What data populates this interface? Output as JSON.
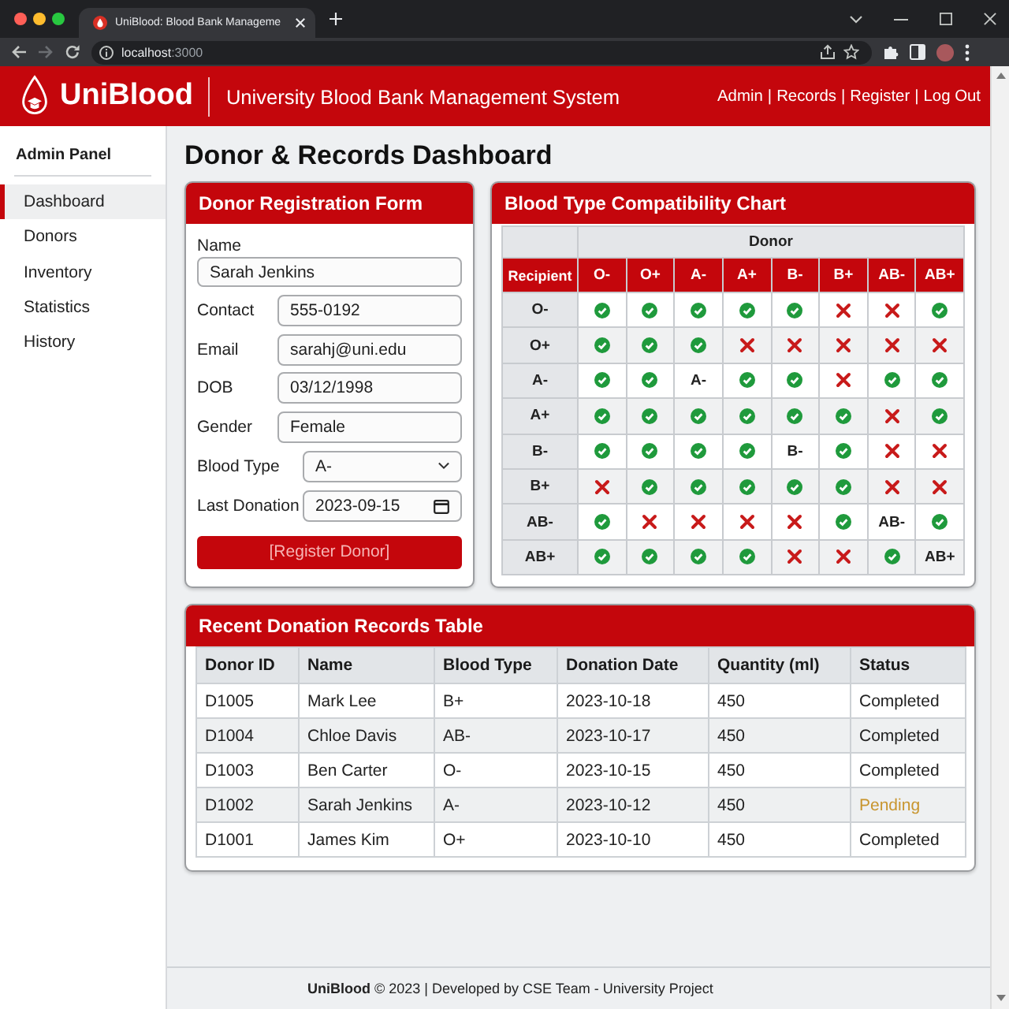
{
  "browser": {
    "tab": {
      "title": "UniBlood: Blood Bank Manageme"
    },
    "address": {
      "host": "localhost",
      "port": ":3000"
    },
    "forward_disabled": true
  },
  "header": {
    "brand": "UniBlood",
    "subtitle": "University Blood Bank Management System",
    "nav": {
      "links": [
        "Admin",
        "Records",
        "Register",
        "Log Out"
      ],
      "separator": "|"
    }
  },
  "sidebar": {
    "title": "Admin Panel",
    "items": [
      {
        "label": "Dashboard",
        "selected": true
      },
      {
        "label": "Donors",
        "selected": false
      },
      {
        "label": "Inventory",
        "selected": false
      },
      {
        "label": "Statistics",
        "selected": false
      },
      {
        "label": "History",
        "selected": false
      }
    ]
  },
  "page_title": "Donor & Records Dashboard",
  "registration_form": {
    "title": "Donor Registration Form",
    "fields": [
      {
        "kind": "stacked",
        "label": "Name",
        "value": "Sarah Jenkins"
      },
      {
        "kind": "text",
        "label": "Contact",
        "value": "555-0192"
      },
      {
        "kind": "text",
        "label": "Email",
        "value": "sarahj@uni.edu"
      },
      {
        "kind": "text",
        "label": "DOB",
        "value": "03/12/1998"
      },
      {
        "kind": "text",
        "label": "Gender",
        "value": "Female"
      },
      {
        "kind": "select",
        "label": "Blood Type",
        "value": "A-"
      },
      {
        "kind": "date",
        "label": "Last Donation",
        "value": "2023-09-15"
      }
    ],
    "submit": "[Register Donor]"
  },
  "compatibility_chart": {
    "title": "Blood Type Compatibility Chart",
    "donor_heading": "Donor",
    "recipient_heading": "Recipient",
    "donor_types": [
      "O-",
      "O+",
      "A-",
      "A+",
      "B-",
      "B+",
      "AB-",
      "AB+"
    ],
    "rows": [
      {
        "recipient": "O-",
        "cells": [
          {
            "kind": "check"
          },
          {
            "kind": "check"
          },
          {
            "kind": "check"
          },
          {
            "kind": "check"
          },
          {
            "kind": "check"
          },
          {
            "kind": "cross"
          },
          {
            "kind": "cross"
          },
          {
            "kind": "check"
          }
        ]
      },
      {
        "recipient": "O+",
        "cells": [
          {
            "kind": "check"
          },
          {
            "kind": "check"
          },
          {
            "kind": "check"
          },
          {
            "kind": "cross"
          },
          {
            "kind": "cross"
          },
          {
            "kind": "cross"
          },
          {
            "kind": "cross"
          },
          {
            "kind": "cross"
          }
        ]
      },
      {
        "recipient": "A-",
        "cells": [
          {
            "kind": "check"
          },
          {
            "kind": "check"
          },
          {
            "kind": "label",
            "text": "A-"
          },
          {
            "kind": "check"
          },
          {
            "kind": "check"
          },
          {
            "kind": "cross"
          },
          {
            "kind": "check"
          },
          {
            "kind": "check"
          }
        ]
      },
      {
        "recipient": "A+",
        "cells": [
          {
            "kind": "check"
          },
          {
            "kind": "check"
          },
          {
            "kind": "check"
          },
          {
            "kind": "check"
          },
          {
            "kind": "check"
          },
          {
            "kind": "check"
          },
          {
            "kind": "cross"
          },
          {
            "kind": "check"
          }
        ]
      },
      {
        "recipient": "B-",
        "cells": [
          {
            "kind": "check"
          },
          {
            "kind": "check"
          },
          {
            "kind": "check"
          },
          {
            "kind": "check"
          },
          {
            "kind": "label",
            "text": "B-"
          },
          {
            "kind": "check"
          },
          {
            "kind": "cross"
          },
          {
            "kind": "cross"
          }
        ]
      },
      {
        "recipient": "B+",
        "cells": [
          {
            "kind": "cross"
          },
          {
            "kind": "check"
          },
          {
            "kind": "check"
          },
          {
            "kind": "check"
          },
          {
            "kind": "check"
          },
          {
            "kind": "check"
          },
          {
            "kind": "cross"
          },
          {
            "kind": "cross"
          }
        ]
      },
      {
        "recipient": "AB-",
        "cells": [
          {
            "kind": "check"
          },
          {
            "kind": "cross"
          },
          {
            "kind": "cross"
          },
          {
            "kind": "cross"
          },
          {
            "kind": "cross"
          },
          {
            "kind": "check"
          },
          {
            "kind": "label",
            "text": "AB-"
          },
          {
            "kind": "check"
          }
        ]
      },
      {
        "recipient": "AB+",
        "cells": [
          {
            "kind": "check"
          },
          {
            "kind": "check"
          },
          {
            "kind": "check"
          },
          {
            "kind": "check"
          },
          {
            "kind": "cross"
          },
          {
            "kind": "cross"
          },
          {
            "kind": "check"
          },
          {
            "kind": "label",
            "text": "AB+"
          }
        ]
      }
    ]
  },
  "records": {
    "title": "Recent Donation Records Table",
    "columns": [
      "Donor ID",
      "Name",
      "Blood Type",
      "Donation Date",
      "Quantity (ml)",
      "Status"
    ],
    "rows": [
      {
        "cells": [
          "D1005",
          "Mark Lee",
          "B+",
          "2023-10-18",
          "450",
          "Completed"
        ],
        "pending": false
      },
      {
        "cells": [
          "D1004",
          "Chloe Davis",
          "AB-",
          "2023-10-17",
          "450",
          "Completed"
        ],
        "pending": false
      },
      {
        "cells": [
          "D1003",
          "Ben Carter",
          "O-",
          "2023-10-15",
          "450",
          "Completed"
        ],
        "pending": false
      },
      {
        "cells": [
          "D1002",
          "Sarah Jenkins",
          "A-",
          "2023-10-12",
          "450",
          "Pending"
        ],
        "pending": true
      },
      {
        "cells": [
          "D1001",
          "James Kim",
          "O+",
          "2023-10-10",
          "450",
          "Completed"
        ],
        "pending": false
      }
    ]
  },
  "footer": "**UniBlood** © 2023 | Developed by CSE Team - University Project"
}
